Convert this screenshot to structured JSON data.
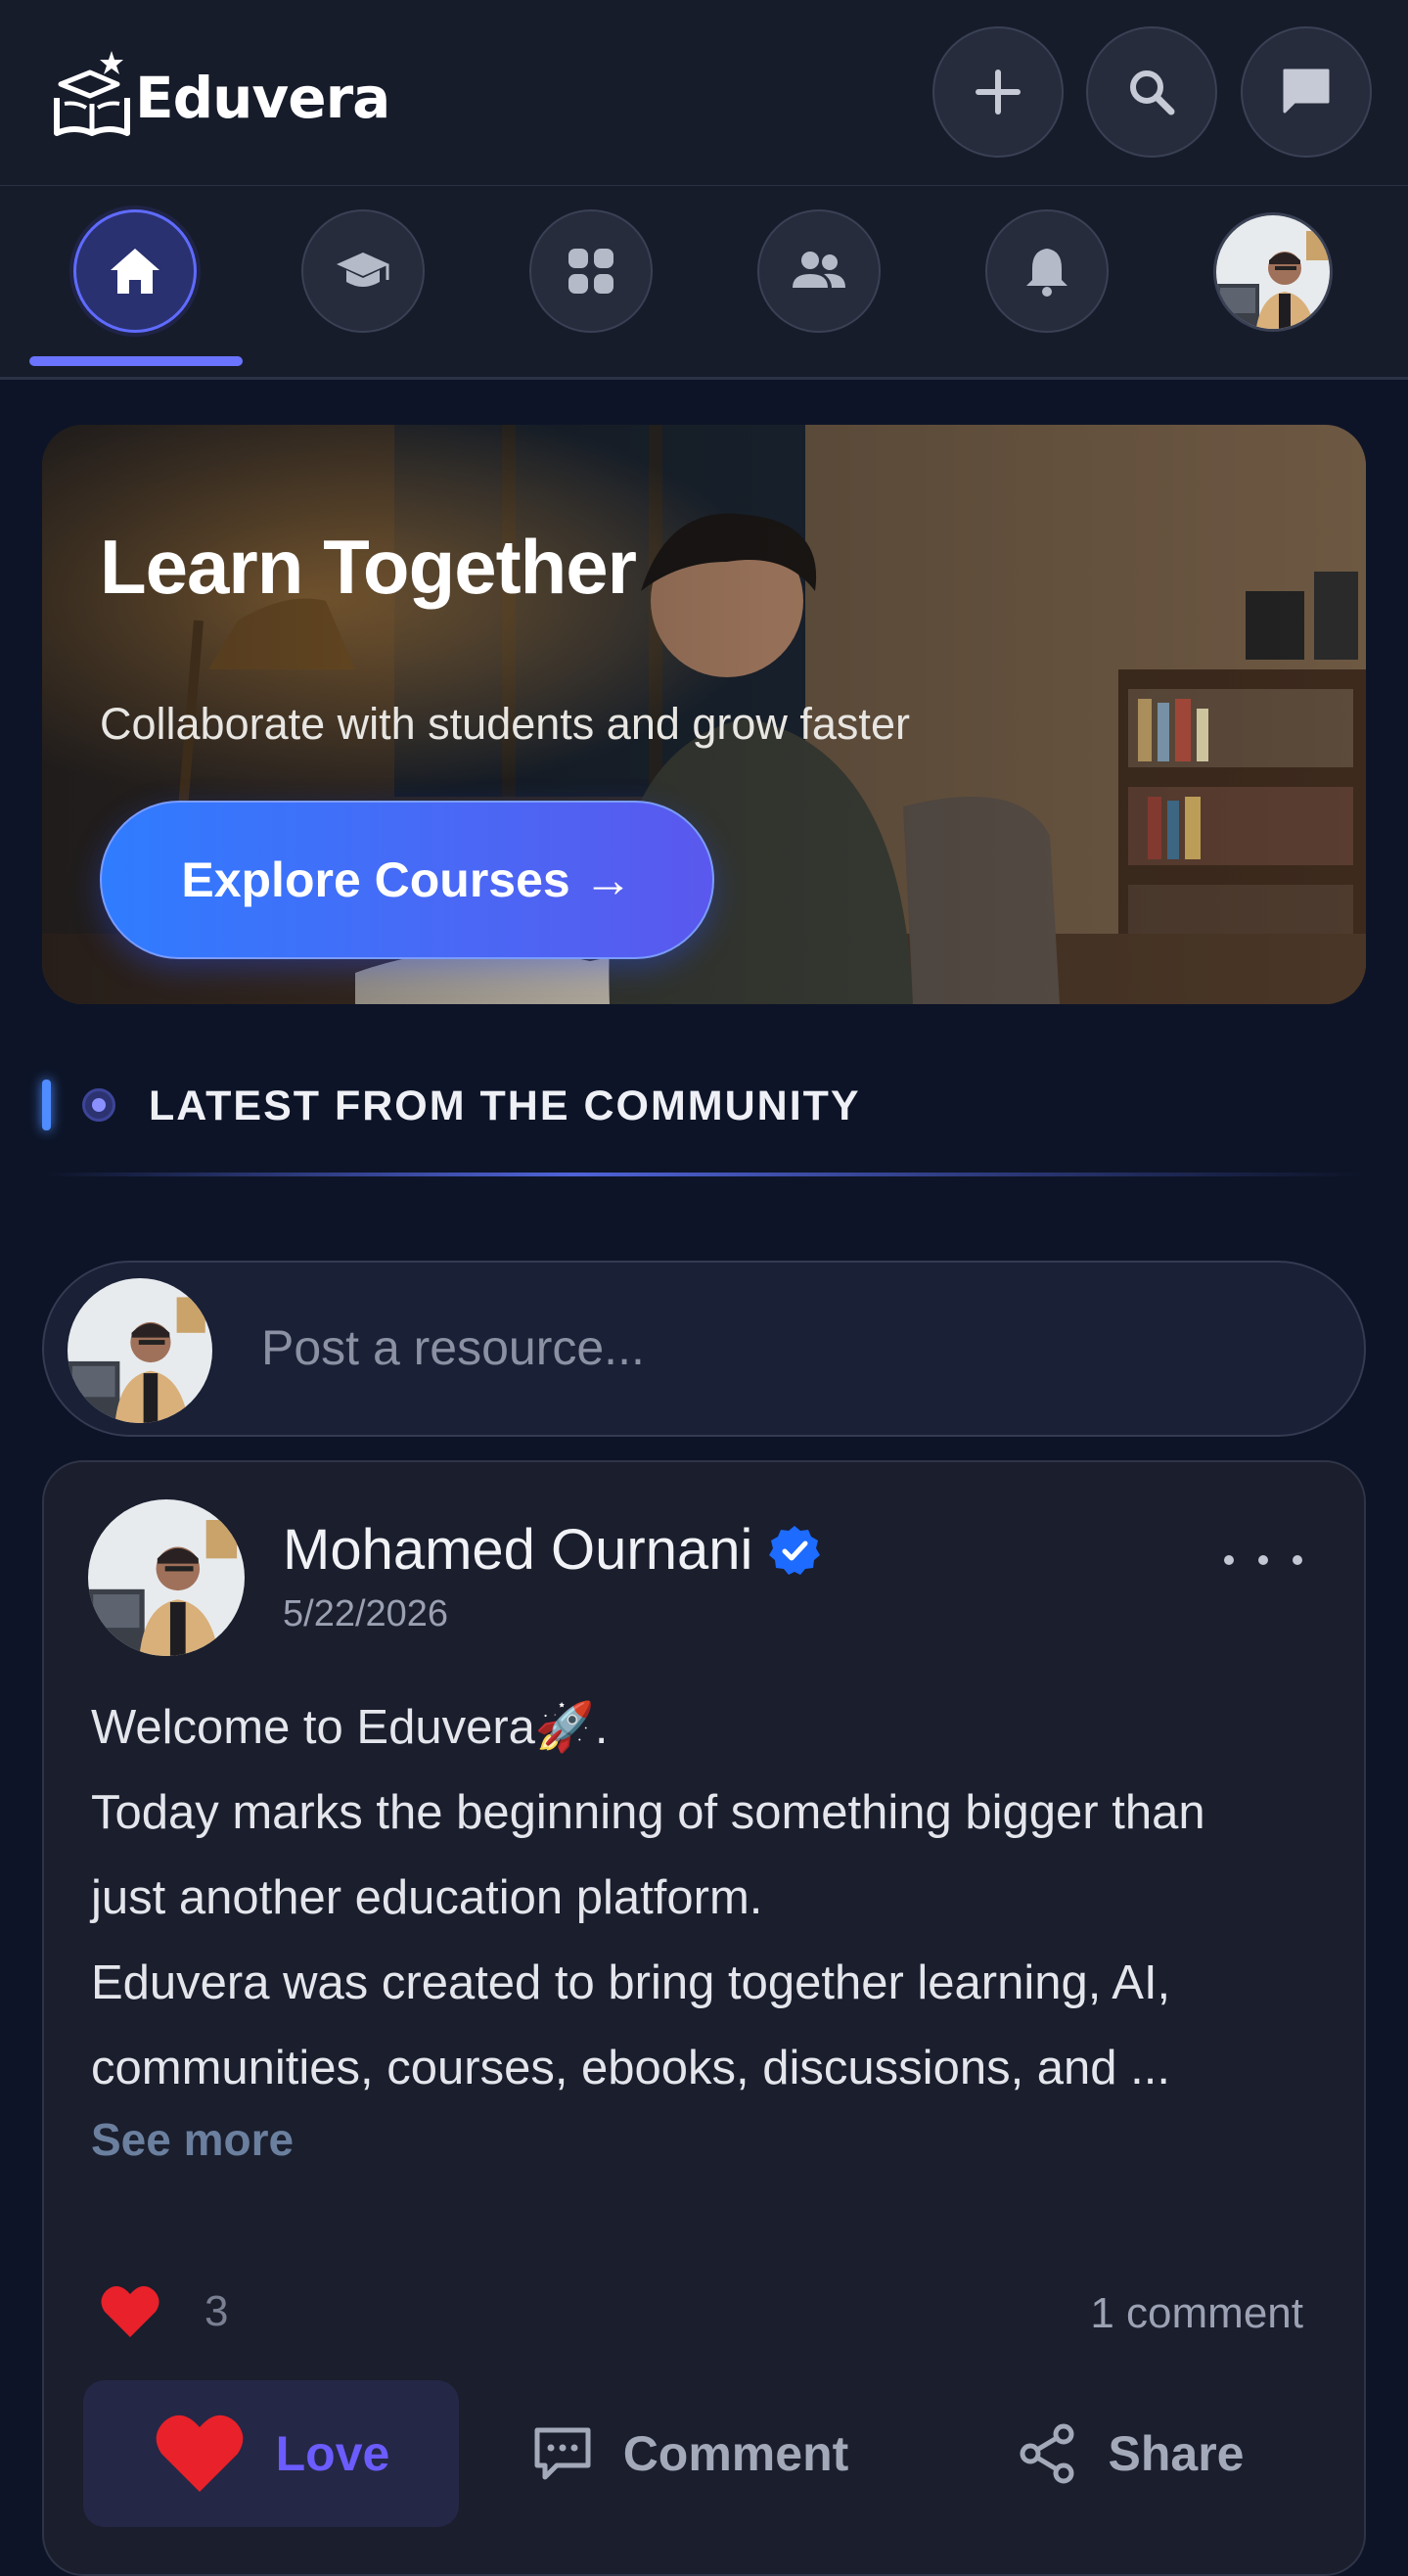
{
  "app": {
    "name": "Eduvera"
  },
  "header": {
    "actions": [
      {
        "icon": "plus-icon"
      },
      {
        "icon": "search-icon"
      },
      {
        "icon": "chat-icon"
      }
    ]
  },
  "nav": {
    "items": [
      {
        "icon": "home-icon",
        "active": true
      },
      {
        "icon": "graduation-cap-icon",
        "active": false
      },
      {
        "icon": "apps-grid-icon",
        "active": false
      },
      {
        "icon": "people-icon",
        "active": false
      },
      {
        "icon": "bell-icon",
        "active": false
      },
      {
        "icon": "profile-avatar",
        "active": false
      }
    ]
  },
  "hero": {
    "title": "Learn Together",
    "subtitle": "Collaborate with students and grow faster",
    "button_label": "Explore Courses →"
  },
  "section": {
    "title": "LATEST FROM THE COMMUNITY"
  },
  "composer": {
    "placeholder": "Post a resource..."
  },
  "post": {
    "author": "Mohamed Ournani",
    "verified": true,
    "date": "5/22/2026",
    "lines": [
      "Welcome to Eduvera🚀.",
      "Today marks the beginning of something bigger than",
      "just another education platform.",
      "Eduvera was created to bring together learning, AI,",
      "communities, courses, ebooks, discussions, and ..."
    ],
    "see_more": "See more",
    "reaction_count": "3",
    "comment_count": "1 comment",
    "actions": {
      "love": "Love",
      "comment": "Comment",
      "share": "Share"
    }
  },
  "colors": {
    "background": "#0d1427",
    "accent": "#6a74ff",
    "button_gradient_start": "#2f7cff",
    "love": "#6b5cff",
    "heart": "#e8212a",
    "verified": "#1d6bff"
  }
}
